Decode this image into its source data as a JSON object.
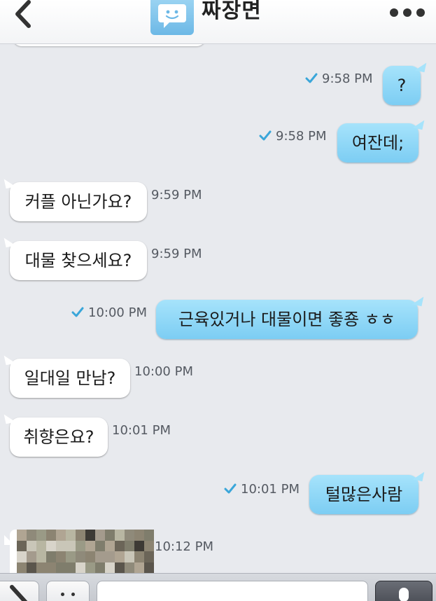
{
  "header": {
    "title": "짜장면",
    "back_icon": "chevron-left-icon",
    "avatar_icon": "chat-bubble-face-icon",
    "more_icon": "more-dots-icon"
  },
  "messages": [
    {
      "direction": "out",
      "text": "?",
      "time": "9:58 PM",
      "read": true
    },
    {
      "direction": "out",
      "text": "여잔데;",
      "time": "9:58 PM",
      "read": true
    },
    {
      "direction": "in",
      "text": "커플 아닌가요?",
      "time": "9:59 PM"
    },
    {
      "direction": "in",
      "text": "대물 찾으세요?",
      "time": "9:59 PM"
    },
    {
      "direction": "out",
      "text": "근육있거나 대물이면 좋죵 ㅎㅎ",
      "time": "10:00 PM",
      "read": true
    },
    {
      "direction": "in",
      "text": "일대일 만남?",
      "time": "10:00 PM"
    },
    {
      "direction": "in",
      "text": "취향은요?",
      "time": "10:01 PM"
    },
    {
      "direction": "out",
      "text": "털많은사람",
      "time": "10:01 PM",
      "read": true
    },
    {
      "direction": "in",
      "type": "image",
      "time": "10:12 PM"
    }
  ],
  "composer": {
    "attach_icon": "pen-icon",
    "emoji_icon": "emoji-icon",
    "input_value": "",
    "mic_icon": "microphone-icon"
  },
  "colors": {
    "out_bubble": "#8ed6f7",
    "in_bubble": "#ffffff",
    "background": "#e8eaee",
    "check": "#3aa6d9"
  }
}
